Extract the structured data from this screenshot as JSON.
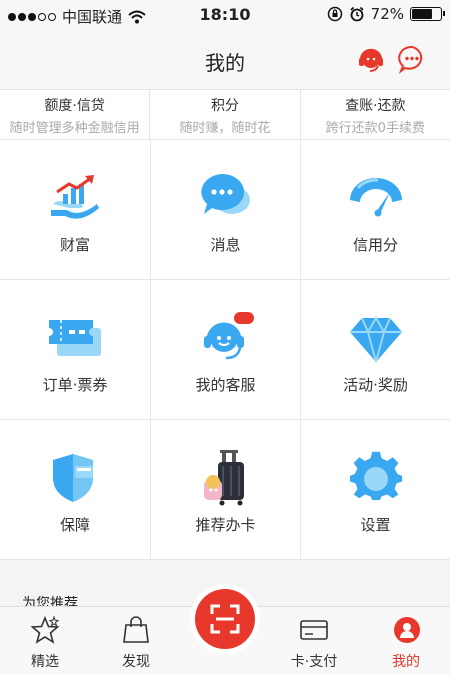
{
  "status_bar": {
    "carrier": "中国联通",
    "time": "18:10",
    "battery": "72%",
    "battery_level": 0.72
  },
  "nav": {
    "title": "我的"
  },
  "quick_row": [
    {
      "title": "额度·信贷",
      "subtitle": "随时管理多种金融信用"
    },
    {
      "title": "积分",
      "subtitle": "随时赚，随时花"
    },
    {
      "title": "查账·还款",
      "subtitle": "跨行还款0手续费"
    }
  ],
  "grid": [
    {
      "label": "财富",
      "icon": "wealth-icon"
    },
    {
      "label": "消息",
      "icon": "message-icon"
    },
    {
      "label": "信用分",
      "icon": "credit-gauge-icon"
    },
    {
      "label": "订单·票券",
      "icon": "ticket-icon"
    },
    {
      "label": "我的客服",
      "icon": "customer-service-icon",
      "badge": "Hi"
    },
    {
      "label": "活动·奖励",
      "icon": "diamond-icon"
    },
    {
      "label": "保障",
      "icon": "shield-icon"
    },
    {
      "label": "推荐办卡",
      "icon": "luggage-icon"
    },
    {
      "label": "设置",
      "icon": "gear-icon"
    }
  ],
  "recommend": {
    "title": "为您推荐"
  },
  "tabs": [
    {
      "label": "精选",
      "icon": "star-icon"
    },
    {
      "label": "发现",
      "icon": "bag-icon"
    },
    {
      "label": "卡·支付",
      "icon": "card-icon"
    },
    {
      "label": "我的",
      "icon": "profile-icon",
      "active": true
    }
  ],
  "colors": {
    "accent": "#e8382c",
    "icon_blue": "#3aa8f0",
    "icon_light": "#9ad8f7"
  }
}
